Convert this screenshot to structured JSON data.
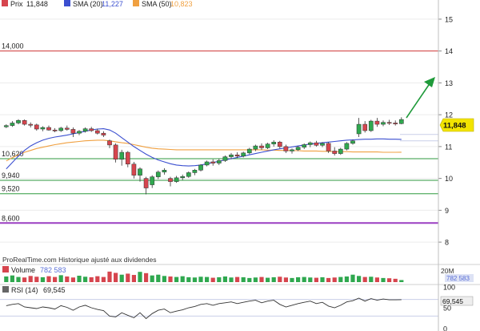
{
  "header": {
    "price_label": "Prix",
    "price_value": "11,848",
    "sma20_label": "SMA (20)",
    "sma20_value": "11,227",
    "sma50_label": "SMA (50)",
    "sma50_value": "10,823"
  },
  "watermark": "ProRealTime.com  Historique ajusté aux dividendes",
  "colors": {
    "up": "#2fa84f",
    "down": "#d6454e",
    "sma20": "#3b4fd0",
    "sma50": "#f0a040",
    "resistance": "#d23a3a",
    "support": "#2f9a3f",
    "support_purple": "#9b3fc2",
    "arrow": "#1f9a3a",
    "price_tag": "#f2e400"
  },
  "chart_data": [
    {
      "type": "candlestick",
      "y_axis": {
        "ticks": [
          "15",
          "14",
          "13",
          "12",
          "11",
          "10",
          "9",
          "8"
        ],
        "ylim": [
          7.6,
          15.3
        ]
      },
      "current_price": {
        "value": 11.848,
        "label": "11,848"
      },
      "levels": [
        {
          "value": 14.0,
          "label": "14,000",
          "kind": "resistance"
        },
        {
          "value": 10.62,
          "label": "10,620",
          "kind": "support"
        },
        {
          "value": 9.94,
          "label": "9,940",
          "kind": "support"
        },
        {
          "value": 9.52,
          "label": "9,520",
          "kind": "support"
        },
        {
          "value": 8.6,
          "label": "8,600",
          "kind": "support_purple"
        }
      ],
      "candles": [
        [
          11.62,
          11.7,
          11.58,
          11.66
        ],
        [
          11.66,
          11.8,
          11.62,
          11.74
        ],
        [
          11.74,
          11.86,
          11.7,
          11.82
        ],
        [
          11.82,
          11.85,
          11.66,
          11.7
        ],
        [
          11.7,
          11.76,
          11.6,
          11.68
        ],
        [
          11.68,
          11.72,
          11.5,
          11.55
        ],
        [
          11.55,
          11.64,
          11.48,
          11.6
        ],
        [
          11.6,
          11.66,
          11.5,
          11.52
        ],
        [
          11.52,
          11.58,
          11.45,
          11.5
        ],
        [
          11.5,
          11.62,
          11.46,
          11.58
        ],
        [
          11.58,
          11.66,
          11.5,
          11.54
        ],
        [
          11.54,
          11.6,
          11.3,
          11.42
        ],
        [
          11.42,
          11.52,
          11.36,
          11.48
        ],
        [
          11.48,
          11.6,
          11.44,
          11.56
        ],
        [
          11.56,
          11.62,
          11.46,
          11.5
        ],
        [
          11.5,
          11.56,
          11.38,
          11.42
        ],
        [
          11.42,
          11.48,
          11.3,
          11.36
        ],
        [
          11.18,
          11.22,
          10.95,
          11.05
        ],
        [
          11.05,
          11.1,
          10.5,
          10.6
        ],
        [
          10.6,
          10.9,
          10.4,
          10.82
        ],
        [
          10.82,
          10.86,
          10.35,
          10.45
        ],
        [
          10.45,
          10.52,
          10.0,
          10.1
        ],
        [
          10.1,
          10.35,
          9.9,
          10.3
        ],
        [
          10.0,
          10.05,
          9.5,
          9.7
        ],
        [
          9.8,
          10.1,
          9.7,
          10.05
        ],
        [
          10.05,
          10.25,
          9.98,
          10.2
        ],
        [
          10.2,
          10.32,
          10.12,
          10.26
        ],
        [
          10.0,
          10.05,
          9.75,
          9.9
        ],
        [
          9.9,
          10.08,
          9.86,
          10.02
        ],
        [
          10.02,
          10.12,
          9.95,
          10.06
        ],
        [
          10.06,
          10.22,
          10.02,
          10.18
        ],
        [
          10.18,
          10.3,
          10.1,
          10.26
        ],
        [
          10.26,
          10.45,
          10.22,
          10.42
        ],
        [
          10.42,
          10.56,
          10.38,
          10.52
        ],
        [
          10.52,
          10.6,
          10.4,
          10.48
        ],
        [
          10.48,
          10.62,
          10.42,
          10.56
        ],
        [
          10.56,
          10.72,
          10.52,
          10.68
        ],
        [
          10.68,
          10.8,
          10.6,
          10.74
        ],
        [
          10.74,
          10.82,
          10.64,
          10.7
        ],
        [
          10.7,
          10.84,
          10.66,
          10.8
        ],
        [
          10.8,
          10.96,
          10.76,
          10.92
        ],
        [
          10.92,
          11.06,
          10.86,
          11.02
        ],
        [
          11.02,
          11.1,
          10.9,
          10.96
        ],
        [
          10.96,
          11.12,
          10.92,
          11.08
        ],
        [
          11.08,
          11.2,
          11.0,
          11.14
        ],
        [
          11.14,
          11.18,
          10.94,
          11.0
        ],
        [
          11.0,
          11.06,
          10.8,
          10.86
        ],
        [
          10.86,
          10.94,
          10.78,
          10.9
        ],
        [
          10.9,
          11.02,
          10.86,
          10.98
        ],
        [
          10.98,
          11.1,
          10.92,
          11.06
        ],
        [
          11.06,
          11.16,
          10.98,
          11.12
        ],
        [
          11.12,
          11.18,
          11.0,
          11.04
        ],
        [
          11.04,
          11.14,
          10.98,
          11.1
        ],
        [
          11.1,
          11.14,
          10.8,
          10.86
        ],
        [
          10.86,
          10.98,
          10.72,
          10.78
        ],
        [
          10.78,
          10.96,
          10.74,
          10.92
        ],
        [
          10.92,
          11.14,
          10.88,
          11.1
        ],
        [
          11.1,
          11.22,
          11.06,
          11.18
        ],
        [
          11.4,
          11.9,
          11.3,
          11.7
        ],
        [
          11.7,
          11.8,
          11.44,
          11.5
        ],
        [
          11.5,
          11.84,
          11.46,
          11.8
        ],
        [
          11.8,
          11.9,
          11.62,
          11.7
        ],
        [
          11.7,
          11.82,
          11.64,
          11.76
        ],
        [
          11.76,
          11.84,
          11.68,
          11.74
        ],
        [
          11.74,
          11.82,
          11.66,
          11.72
        ],
        [
          11.72,
          11.92,
          11.7,
          11.85
        ]
      ],
      "sma20": [
        10.3,
        10.5,
        10.7,
        10.88,
        11.02,
        11.12,
        11.2,
        11.26,
        11.3,
        11.33,
        11.36,
        11.4,
        11.44,
        11.48,
        11.52,
        11.55,
        11.56,
        11.52,
        11.42,
        11.28,
        11.14,
        11.0,
        10.88,
        10.76,
        10.66,
        10.58,
        10.52,
        10.46,
        10.42,
        10.4,
        10.39,
        10.4,
        10.42,
        10.46,
        10.5,
        10.54,
        10.58,
        10.62,
        10.66,
        10.7,
        10.74,
        10.78,
        10.82,
        10.86,
        10.9,
        10.93,
        10.96,
        10.99,
        11.02,
        11.05,
        11.08,
        11.1,
        11.12,
        11.14,
        11.16,
        11.18,
        11.2,
        11.21,
        11.22,
        11.23,
        11.23,
        11.24,
        11.24,
        11.23,
        11.23,
        11.227
      ],
      "sma50": [
        10.55,
        10.65,
        10.74,
        10.82,
        10.88,
        10.94,
        10.98,
        11.02,
        11.06,
        11.09,
        11.12,
        11.14,
        11.16,
        11.18,
        11.19,
        11.2,
        11.2,
        11.18,
        11.15,
        11.12,
        11.1,
        11.06,
        11.02,
        10.98,
        10.95,
        10.93,
        10.92,
        10.91,
        10.9,
        10.9,
        10.9,
        10.9,
        10.9,
        10.9,
        10.9,
        10.9,
        10.9,
        10.9,
        10.9,
        10.9,
        10.9,
        10.9,
        10.9,
        10.89,
        10.89,
        10.88,
        10.88,
        10.87,
        10.87,
        10.86,
        10.86,
        10.86,
        10.85,
        10.85,
        10.84,
        10.84,
        10.84,
        10.83,
        10.83,
        10.83,
        10.83,
        10.83,
        10.82,
        10.82,
        10.82,
        10.823
      ]
    },
    {
      "type": "bar",
      "series_name": "Volume",
      "current_label": "782 583",
      "y_axis": {
        "ticks": [
          "20M"
        ],
        "ylim": [
          0,
          20
        ]
      },
      "values": [
        2.2,
        2.6,
        2.0,
        1.8,
        2.4,
        2.1,
        1.9,
        2.3,
        2.0,
        2.7,
        2.2,
        1.8,
        2.5,
        2.1,
        1.9,
        2.3,
        2.0,
        4.1,
        3.6,
        2.9,
        3.3,
        2.8,
        4.0,
        3.5,
        2.6,
        2.9,
        2.4,
        2.2,
        2.0,
        2.3,
        1.9,
        1.8,
        2.1,
        2.0,
        1.7,
        1.9,
        2.2,
        1.8,
        2.0,
        1.9,
        1.6,
        1.8,
        2.0,
        1.7,
        1.9,
        2.1,
        1.8,
        1.6,
        1.9,
        2.0,
        1.8,
        1.7,
        1.9,
        1.6,
        1.8,
        2.0,
        2.2,
        2.9,
        2.4,
        2.0,
        2.1,
        1.8,
        1.6,
        1.5,
        1.3,
        0.8
      ]
    },
    {
      "type": "line",
      "series_name": "RSI (14)",
      "current_label": "69,545",
      "y_axis": {
        "ticks": [
          "100",
          "50",
          "0"
        ],
        "ylim": [
          0,
          100
        ]
      },
      "values": [
        55,
        58,
        60,
        52,
        50,
        48,
        52,
        50,
        47,
        55,
        51,
        44,
        52,
        56,
        50,
        46,
        43,
        30,
        28,
        38,
        32,
        26,
        38,
        24,
        36,
        44,
        47,
        38,
        42,
        45,
        50,
        53,
        58,
        60,
        56,
        60,
        62,
        64,
        60,
        63,
        66,
        68,
        62,
        66,
        68,
        58,
        52,
        56,
        60,
        63,
        66,
        60,
        63,
        54,
        50,
        56,
        64,
        67,
        73,
        66,
        72,
        68,
        71,
        69,
        69,
        69.5
      ]
    }
  ]
}
